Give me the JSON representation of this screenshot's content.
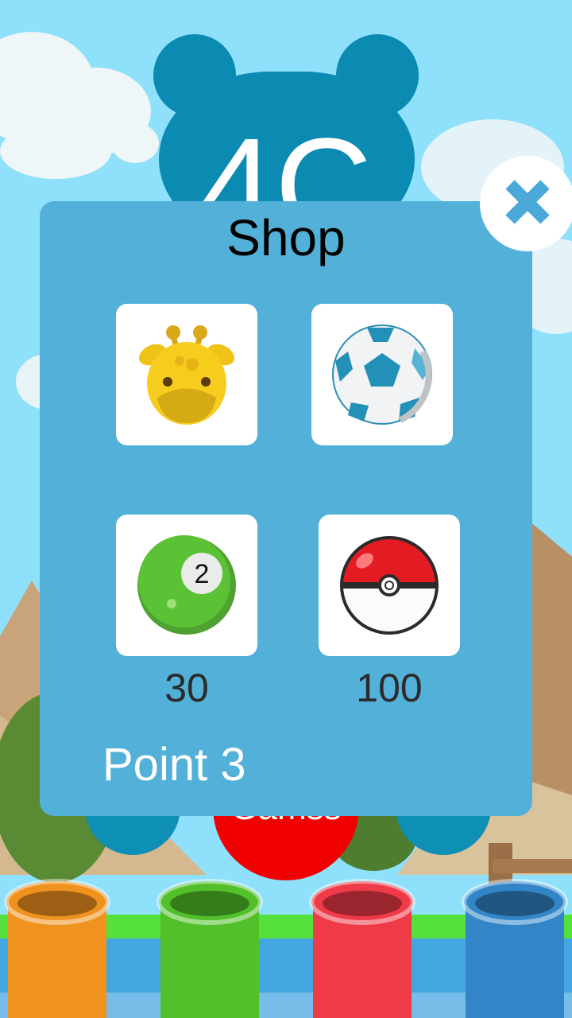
{
  "background": {
    "logo_text": "4C",
    "play_button_label": "Gamss",
    "tube_colors": [
      "#f0921e",
      "#52c02a",
      "#ef3a48",
      "#3286c8"
    ]
  },
  "shop": {
    "title": "Shop",
    "items": [
      {
        "name": "giraffe",
        "icon": "giraffe-icon",
        "price": ""
      },
      {
        "name": "soccer ball",
        "icon": "soccer-ball-icon",
        "price": ""
      },
      {
        "name": "green ball 2",
        "icon": "green-ball-icon",
        "price": "30"
      },
      {
        "name": "pokeball",
        "icon": "pokeball-icon",
        "price": "100"
      }
    ],
    "points_label": "Point 3",
    "close_icon": "close-icon"
  },
  "colors": {
    "panel": "#53b1d9",
    "sky": "#8fe0fb",
    "close_x": "#4aa9d8"
  }
}
